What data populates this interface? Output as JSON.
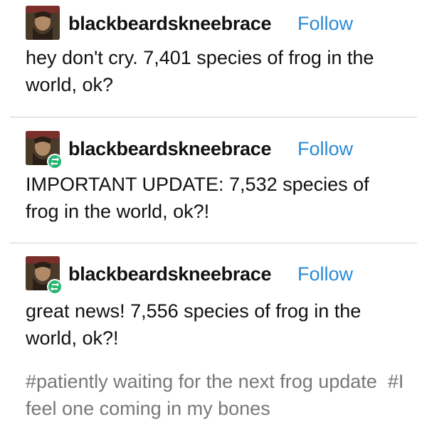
{
  "posts": [
    {
      "username": "blackbeardskneebrace",
      "follow_label": "Follow",
      "text": "hey don't cry. 7,401 species of frog in the world, ok?",
      "reblogged": false
    },
    {
      "username": "blackbeardskneebrace",
      "follow_label": "Follow",
      "text": "IMPORTANT UPDATE: 7,532 species of frog in the world, ok?!",
      "reblogged": true
    },
    {
      "username": "blackbeardskneebrace",
      "follow_label": "Follow",
      "text": "great news! 7,556 species of frog in the world, ok?!",
      "reblogged": true
    }
  ],
  "tags": [
    "#patiently waiting for the next frog update",
    "#I feel one coming in my bones"
  ],
  "colors": {
    "follow": "#2b8ad4",
    "tag": "#777777",
    "reblog_badge": "#2bb673",
    "divider": "#cfcfcf"
  },
  "icons": {
    "avatar": "avatar-image",
    "reblog": "reblog-icon"
  }
}
